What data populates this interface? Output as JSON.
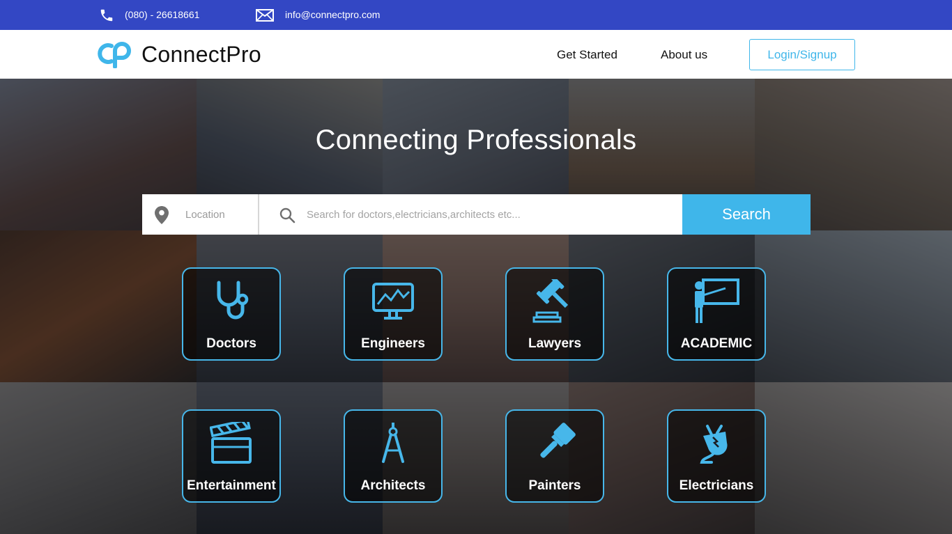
{
  "topbar": {
    "phone": "(080) - 26618661",
    "email": "info@connectpro.com",
    "phone_icon": "phone-icon",
    "mail_icon": "mail-icon"
  },
  "header": {
    "brand": "ConnectPro",
    "nav": {
      "get_started": "Get Started",
      "about": "About us",
      "login": "Login/Signup"
    }
  },
  "hero": {
    "title": "Connecting Professionals"
  },
  "search": {
    "location_placeholder": "Location",
    "query_placeholder": "Search for doctors,electricians,architects etc...",
    "button": "Search"
  },
  "categories": [
    {
      "label": "Doctors",
      "icon": "stethoscope-icon"
    },
    {
      "label": "Engineers",
      "icon": "monitor-chart-icon"
    },
    {
      "label": "Lawyers",
      "icon": "gavel-icon"
    },
    {
      "label": "ACADEMIC",
      "icon": "teacher-board-icon"
    },
    {
      "label": "Entertainment",
      "icon": "clapperboard-icon"
    },
    {
      "label": "Architects",
      "icon": "compass-icon"
    },
    {
      "label": "Painters",
      "icon": "paintbrush-icon"
    },
    {
      "label": "Electricians",
      "icon": "plug-icon"
    }
  ],
  "colors": {
    "topbar": "#3347c4",
    "accent": "#3fb6ea",
    "card_border": "#47b7ea"
  }
}
